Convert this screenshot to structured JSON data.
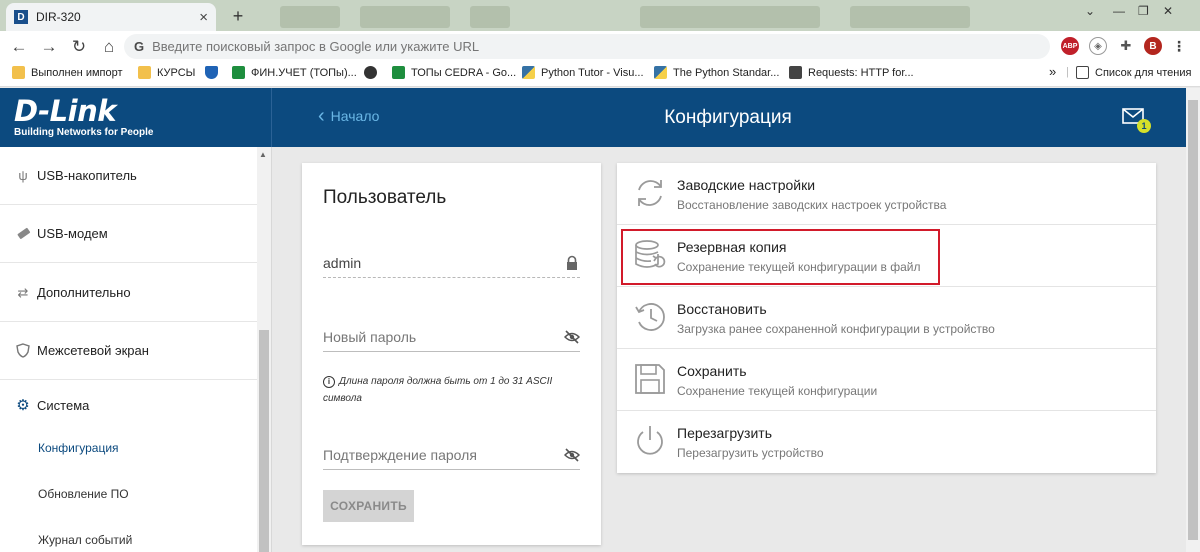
{
  "browser": {
    "tab_title": "DIR-320",
    "tab_favicon": "D",
    "new_tab": "+",
    "omnibox_icon": "G",
    "omnibox_placeholder": "Введите поисковый запрос в Google или укажите URL",
    "extension_abp": "ABP",
    "profile_initial": "B",
    "bookmarks": [
      {
        "label": "Выполнен импорт",
        "icon": "folder-icon",
        "color": "#f2c04c"
      },
      {
        "label": "КУРСЫ",
        "icon": "folder-icon",
        "color": "#f2c04c"
      },
      {
        "label": "",
        "icon": "shield-icon",
        "color": "#1f63b5"
      },
      {
        "label": "ФИН.УЧЕТ (ТОПы)...",
        "icon": "sheets-icon",
        "color": "#1e8e3e"
      },
      {
        "label": "",
        "icon": "globe-icon",
        "color": "#333333"
      },
      {
        "label": "ТОПы CEDRA - Go...",
        "icon": "sheets-icon",
        "color": "#1e8e3e"
      },
      {
        "label": "Python Tutor - Visu...",
        "icon": "python-icon",
        "color": "#3572a5"
      },
      {
        "label": "The Python Standar...",
        "icon": "python-icon",
        "color": "#3572a5"
      },
      {
        "label": "Requests: HTTP for...",
        "icon": "book-icon",
        "color": "#444444"
      }
    ],
    "bookmarks_overflow": "»",
    "reading_list": "Список для чтения"
  },
  "header": {
    "logo": "D-Link",
    "tagline": "Building Networks for People",
    "back_label": "Начало",
    "title": "Конфигурация",
    "notification_count": "1"
  },
  "sidebar": {
    "items": [
      {
        "label": "USB-накопитель",
        "icon": "usb-icon"
      },
      {
        "label": "USB-модем",
        "icon": "modem-icon"
      },
      {
        "label": "Дополнительно",
        "icon": "arrows-icon"
      },
      {
        "label": "Межсетевой экран",
        "icon": "shield-icon"
      },
      {
        "label": "Система",
        "icon": "gear-icon"
      }
    ],
    "subitems": [
      {
        "label": "Конфигурация",
        "active": true
      },
      {
        "label": "Обновление ПО",
        "active": false
      },
      {
        "label": "Журнал событий",
        "active": false
      }
    ]
  },
  "user_panel": {
    "title": "Пользователь",
    "username": "admin",
    "new_password_placeholder": "Новый пароль",
    "hint": "Длина пароля должна быть от 1 до 31 ASCII символа",
    "confirm_password_placeholder": "Подтверждение пароля",
    "save_label": "СОХРАНИТЬ"
  },
  "actions": [
    {
      "title": "Заводские настройки",
      "desc": "Восстановление заводских настроек устройства",
      "icon": "reset-icon"
    },
    {
      "title": "Резервная копия",
      "desc": "Сохранение текущей конфигурации в файл",
      "icon": "database-backup-icon"
    },
    {
      "title": "Восстановить",
      "desc": "Загрузка ранее сохраненной конфигурации в устройство",
      "icon": "history-icon"
    },
    {
      "title": "Сохранить",
      "desc": "Сохранение текущей конфигурации",
      "icon": "floppy-icon"
    },
    {
      "title": "Перезагрузить",
      "desc": "Перезагрузить устройство",
      "icon": "power-icon"
    }
  ],
  "colors": {
    "header_bg": "#0c4a7f",
    "accent_link": "#6ab7e6",
    "highlight": "#d21a2a",
    "badge": "#d5e02a"
  }
}
